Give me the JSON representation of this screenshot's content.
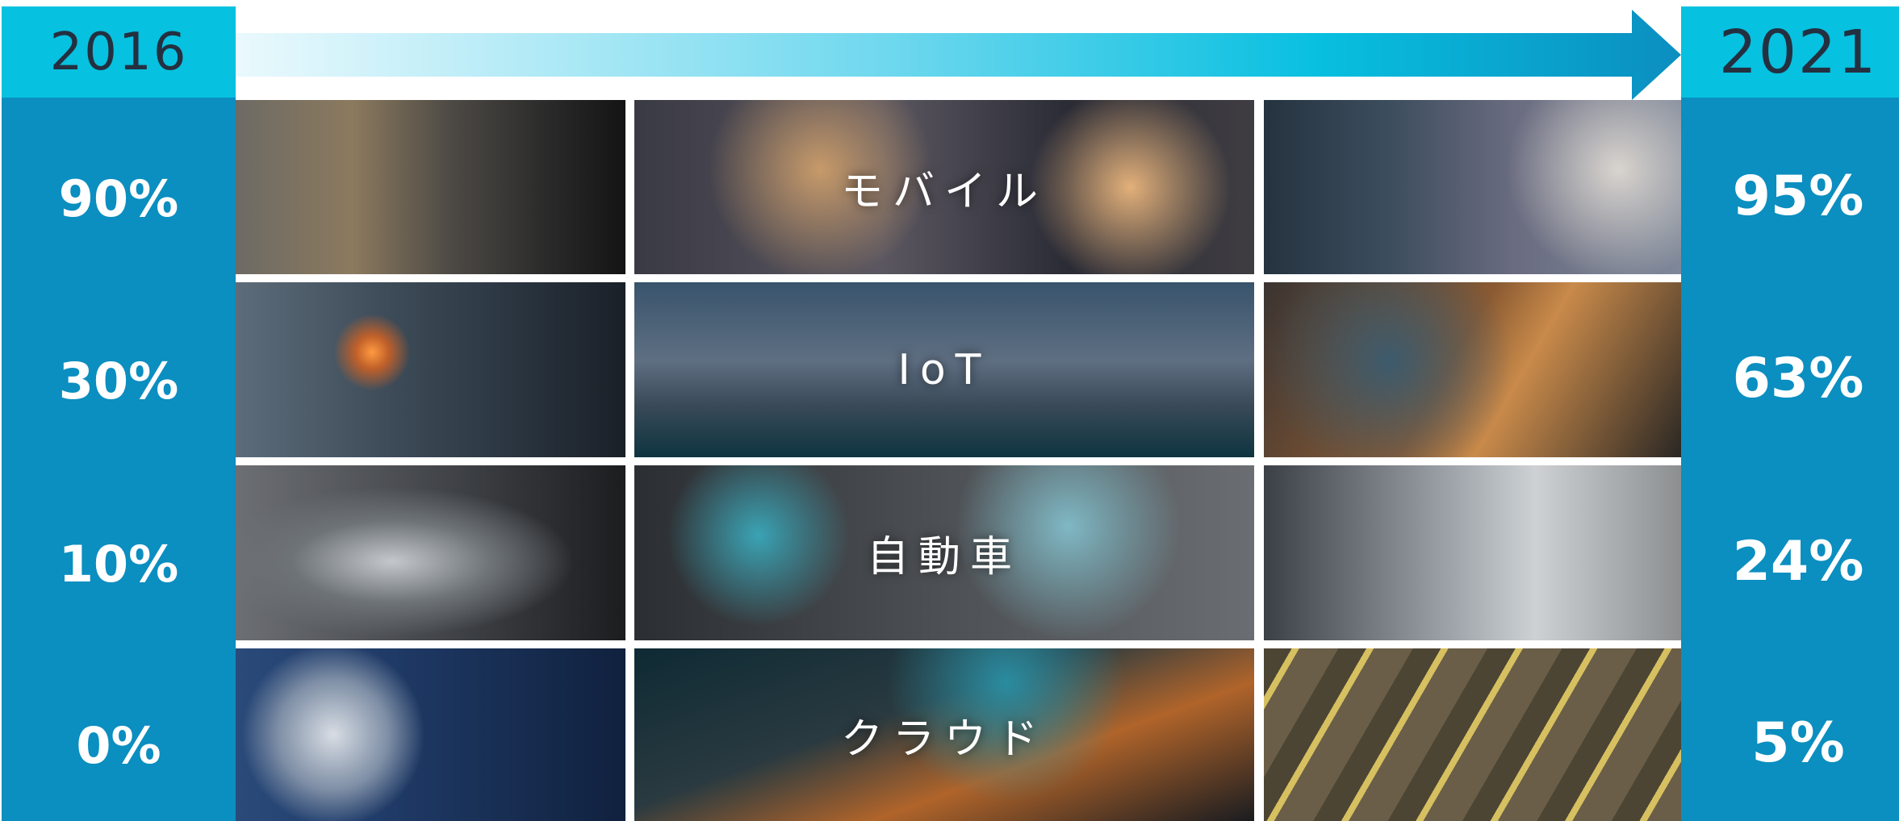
{
  "timeline": {
    "start_year": "2016",
    "end_year": "2021"
  },
  "rows": [
    {
      "category": "モバイル",
      "start_value": "90%",
      "end_value": "95%"
    },
    {
      "category": "IoT",
      "start_value": "30%",
      "end_value": "63%"
    },
    {
      "category": "自動車",
      "start_value": "10%",
      "end_value": "24%"
    },
    {
      "category": "クラウド",
      "start_value": "0%",
      "end_value": "5%"
    }
  ],
  "colors": {
    "header_cyan": "#06c1e0",
    "column_blue": "#0b8ec0",
    "year_text": "#243040",
    "arrow_start": "#eaf9fd",
    "arrow_end": "#0b8ec0"
  }
}
